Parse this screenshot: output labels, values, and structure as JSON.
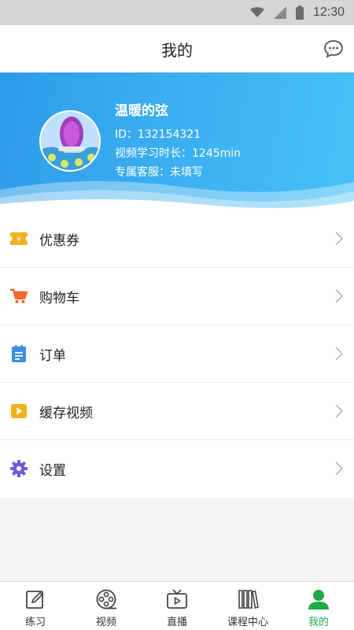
{
  "status_bar": {
    "time": "12:30"
  },
  "header": {
    "title": "我的"
  },
  "profile": {
    "name": "温暖的弦",
    "id_line": "ID：132154321",
    "study_time_line": "视频学习时长：1245min",
    "service_line": "专属客服：未填写"
  },
  "menu": {
    "items": [
      {
        "label": "优惠券",
        "icon": "coupon-icon",
        "color": "#f1b11e"
      },
      {
        "label": "购物车",
        "icon": "cart-icon",
        "color": "#f26a2c"
      },
      {
        "label": "订单",
        "icon": "order-icon",
        "color": "#3a8ee6"
      },
      {
        "label": "缓存视频",
        "icon": "cached-video-icon",
        "color": "#f1b11e"
      },
      {
        "label": "设置",
        "icon": "gear-icon",
        "color": "#6c5bd6"
      }
    ]
  },
  "tabbar": {
    "items": [
      {
        "label": "练习",
        "icon": "pencil-icon"
      },
      {
        "label": "视频",
        "icon": "film-reel-icon"
      },
      {
        "label": "直播",
        "icon": "tv-icon"
      },
      {
        "label": "课程中心",
        "icon": "books-icon"
      },
      {
        "label": "我的",
        "icon": "person-icon",
        "active": true
      }
    ],
    "active_color": "#1faa44"
  }
}
